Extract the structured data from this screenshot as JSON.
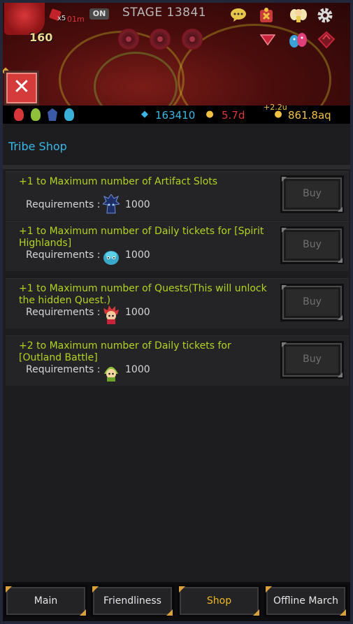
{
  "colors": {
    "title_accent": "#38b8e8",
    "item_title": "#b3d321",
    "active_nav": "#f0b824",
    "close_button": "#d63b3b",
    "gems": "#38b8e8",
    "medals": "#e0333a",
    "gold": "#f0c040"
  },
  "hud": {
    "hero_level": "160",
    "multiplier": "x5",
    "timer": "01m",
    "toggle": "ON",
    "stage": "STAGE 13841",
    "icons": [
      "chat-icon",
      "quest-icon",
      "fairy-icon",
      "gear-icon",
      "dropdown-arrow-icon",
      "pets-icon",
      "red-gem-icon"
    ],
    "close_icon": "close-icon"
  },
  "resources": {
    "party_icons": [
      "red-hair-hero-icon",
      "green-hood-hero-icon",
      "spiky-blue-hero-icon",
      "blue-blob-hero-icon"
    ],
    "gems": "163410",
    "medals": "5.7d",
    "gold_rate": "+2.2u",
    "gold": "861.8aq"
  },
  "panel": {
    "title": "Tribe Shop",
    "requirements_label": "Requirements :",
    "items": [
      {
        "title": "+1 to Maximum number of Artifact Slots",
        "icon": "spiky-blue-tribe-icon",
        "requirement": "1000",
        "button": "Buy"
      },
      {
        "title": "+1 to Maximum number of Daily tickets for [Spirit Highlands]",
        "icon": "blue-blob-tribe-icon",
        "requirement": "1000",
        "button": "Buy"
      },
      {
        "title": "+1 to Maximum number of Quests(This will unlock the hidden Quest.)",
        "icon": "red-hair-tribe-icon",
        "requirement": "1000",
        "button": "Buy"
      },
      {
        "title": "+2 to Maximum number of Daily tickets for [Outland Battle]",
        "icon": "green-hood-tribe-icon",
        "requirement": "1000",
        "button": "Buy"
      }
    ]
  },
  "nav": {
    "items": [
      "Main",
      "Friendliness",
      "Shop",
      "Offline March"
    ],
    "active": "Shop"
  }
}
